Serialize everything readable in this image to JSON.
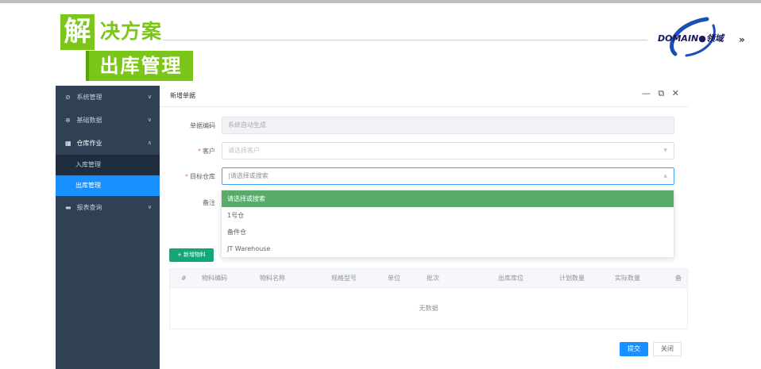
{
  "banner": {
    "kai": "解",
    "title": "决方案",
    "subtitle": "出库管理",
    "logo_text": "DOMAIN●领域",
    "chevron": "»"
  },
  "sidebar": {
    "items": [
      {
        "label": "系统管理",
        "icon": "⊘",
        "chev": "∨"
      },
      {
        "label": "基础数据",
        "icon": "⊕",
        "chev": "∨"
      },
      {
        "label": "仓库作业",
        "icon": "▦",
        "chev": "∧"
      },
      {
        "label": "报表查询",
        "icon": "▬",
        "chev": "∨"
      }
    ],
    "sub_items": [
      {
        "label": "入库管理"
      },
      {
        "label": "出库管理"
      }
    ]
  },
  "dialog": {
    "title": "新增单据",
    "controls": "— ⧉ ✕",
    "fields": {
      "code_label": "单据编码",
      "code_placeholder": "系统自动生成",
      "customer_label": "客户",
      "customer_placeholder": "请选择客户",
      "warehouse_label": "目标仓库",
      "warehouse_placeholder": "请选择或搜索",
      "remark_label": "备注"
    },
    "dropdown": [
      "请选择或搜索",
      "1号仓",
      "备件仓",
      "JT Warehouse"
    ],
    "add_button": "+ 新增物料",
    "table": {
      "headers": [
        "#",
        "物料编码",
        "物料名称",
        "规格型号",
        "单位",
        "批次",
        "出库库位",
        "计划数量",
        "实际数量",
        "备"
      ],
      "empty_text": "无数据"
    },
    "submit_label": "提交",
    "close_label": "关闭"
  }
}
